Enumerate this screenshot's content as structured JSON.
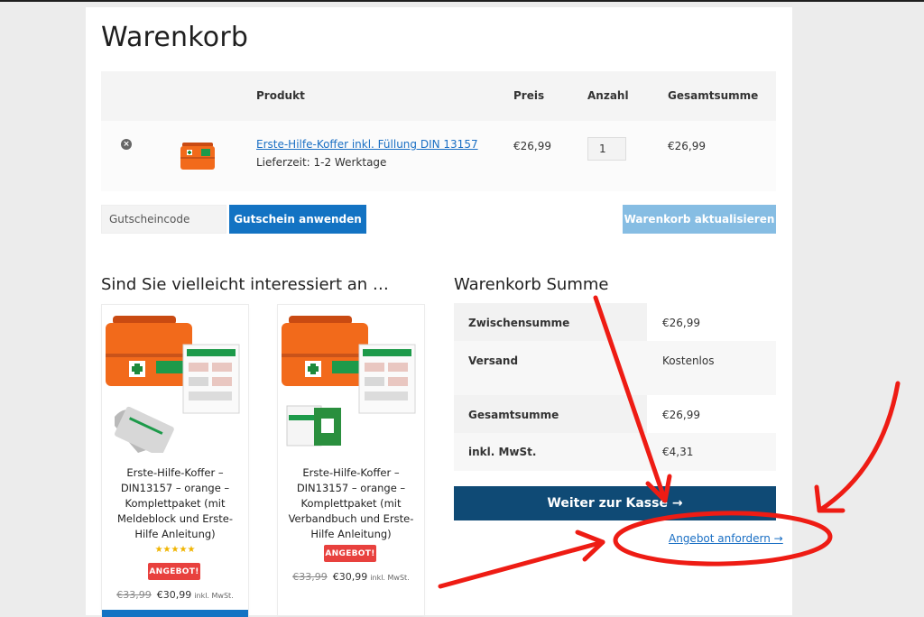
{
  "page": {
    "title": "Warenkorb"
  },
  "cart_table": {
    "headers": {
      "product": "Produkt",
      "price": "Preis",
      "quantity": "Anzahl",
      "total": "Gesamtsumme"
    },
    "items": [
      {
        "remove_icon": "remove-circle-icon",
        "name": "Erste-Hilfe-Koffer inkl. Füllung DIN 13157",
        "delivery": "Lieferzeit: 1-2 Werktage",
        "price": "€26,99",
        "quantity": "1",
        "total": "€26,99"
      }
    ]
  },
  "coupon": {
    "placeholder": "Gutscheincode",
    "apply_label": "Gutschein anwenden",
    "update_label": "Warenkorb aktualisieren"
  },
  "cross_sells": {
    "heading": "Sind Sie vielleicht interessiert an …",
    "products": [
      {
        "title": "Erste-Hilfe-Koffer – DIN13157 – orange – Komplettpaket (mit Meldeblock und Erste-Hilfe Anleitung)",
        "rating": 5,
        "stars": "★★★★★",
        "badge": "ANGEBOT!",
        "old_price": "€33,99",
        "new_price": "€30,99",
        "tax_note": "inkl. MwSt."
      },
      {
        "title": "Erste-Hilfe-Koffer – DIN13157 – orange – Komplettpaket (mit Verbandbuch und Erste-Hilfe Anleitung)",
        "badge": "ANGEBOT!",
        "old_price": "€33,99",
        "new_price": "€30,99",
        "tax_note": "inkl. MwSt."
      }
    ]
  },
  "totals": {
    "heading": "Warenkorb Summe",
    "rows": [
      {
        "label": "Zwischensumme",
        "value": "€26,99"
      },
      {
        "label": "Versand",
        "value": "Kostenlos"
      },
      {
        "label": "Gesamtsumme",
        "value": "€26,99"
      },
      {
        "label": "inkl. MwSt.",
        "value": "€4,31"
      }
    ],
    "checkout_label": "Weiter zur Kasse →",
    "quote_link": "Angebot anfordern →"
  },
  "colors": {
    "primary_button": "#1373c3",
    "checkout_button": "#0f4a75",
    "disabled_button": "#86bde3",
    "link": "#1a6fc4",
    "sale_badge": "#e8413e",
    "annotation": "#ee1c14"
  }
}
